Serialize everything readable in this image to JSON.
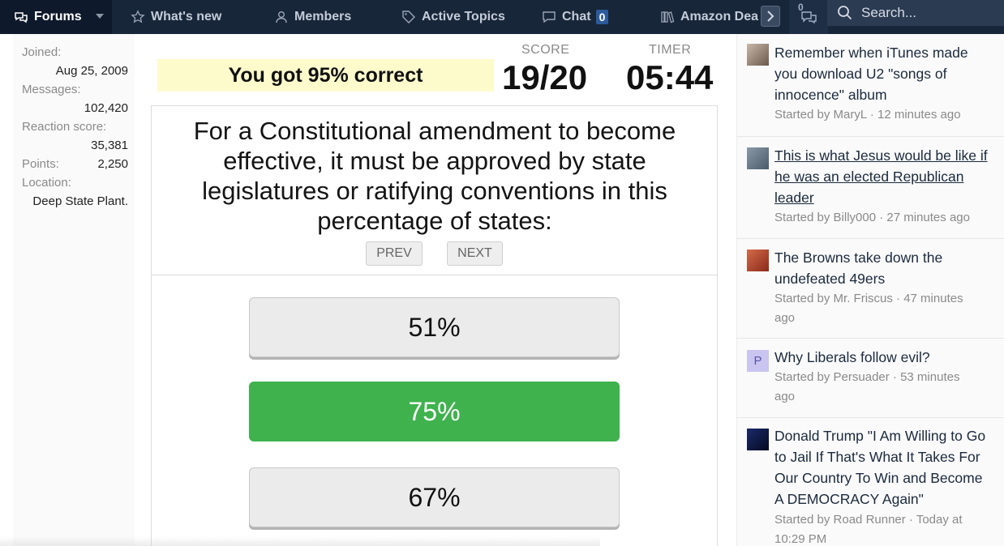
{
  "nav": {
    "items": [
      {
        "label": "Forums",
        "icon": "chat-bubbles-icon"
      },
      {
        "label": "What's new",
        "icon": "star-icon"
      },
      {
        "label": "Members",
        "icon": "person-icon"
      },
      {
        "label": "Active Topics",
        "icon": "tag-icon"
      },
      {
        "label": "Chat",
        "icon": "chat-bubble-icon",
        "badge": "0"
      },
      {
        "label": "Amazon Dea",
        "icon": "books-icon"
      }
    ],
    "alerts_badge": "0",
    "search_label": "Search..."
  },
  "profile": {
    "joined_label": "Joined:",
    "joined_value": "Aug 25, 2009",
    "messages_label": "Messages:",
    "messages_value": "102,420",
    "reaction_label": "Reaction score:",
    "reaction_value": "35,381",
    "points_label": "Points:",
    "points_value": "2,250",
    "location_label": "Location:",
    "location_value": "Deep State Plant."
  },
  "quiz": {
    "result": "You got 95% correct",
    "score_label": "SCORE",
    "score_value": "19/20",
    "timer_label": "TIMER",
    "timer_value": "05:44",
    "question_lines": [
      "For a Constitutional amendment to become",
      "effective, it must be approved by state",
      "legislatures or ratifying conventions in this",
      "percentage of states:"
    ],
    "prev_label": "PREV",
    "next_label": "NEXT",
    "answers": [
      {
        "label": "51%",
        "state": "neutral"
      },
      {
        "label": "75%",
        "state": "correct"
      },
      {
        "label": "67%",
        "state": "neutral"
      }
    ],
    "correct_color": "#3fb24d"
  },
  "sidebar": {
    "threads": [
      {
        "title_lines": [
          "Remember when iTunes made",
          "you download U2 \"songs of",
          "innocence\" album"
        ],
        "meta_lines": [
          "Started by MaryL · 12 minutes ago"
        ],
        "underlined": false
      },
      {
        "title_lines": [
          "This is what Jesus would be like if",
          "he was an elected Republican",
          "leader"
        ],
        "meta_lines": [
          "Started by Billy000 · 27 minutes ago"
        ],
        "underlined": true
      },
      {
        "title_lines": [
          "The Browns take down the",
          "undefeated 49ers"
        ],
        "meta_lines": [
          "Started by Mr. Friscus · 47 minutes",
          "ago"
        ],
        "underlined": false
      },
      {
        "title_lines": [
          "Why Liberals follow evil?"
        ],
        "meta_lines": [
          "Started by Persuader · 53 minutes",
          "ago"
        ],
        "underlined": false,
        "avatar_letter": "P"
      },
      {
        "title_lines": [
          "Donald Trump \"I Am Willing to Go",
          "to Jail If That's What It Takes For",
          "Our Country To Win and Become",
          "A DEMOCRACY Again\""
        ],
        "meta_lines": [
          "Started by Road Runner · Today at",
          "10:29 PM"
        ],
        "underlined": false
      }
    ]
  }
}
